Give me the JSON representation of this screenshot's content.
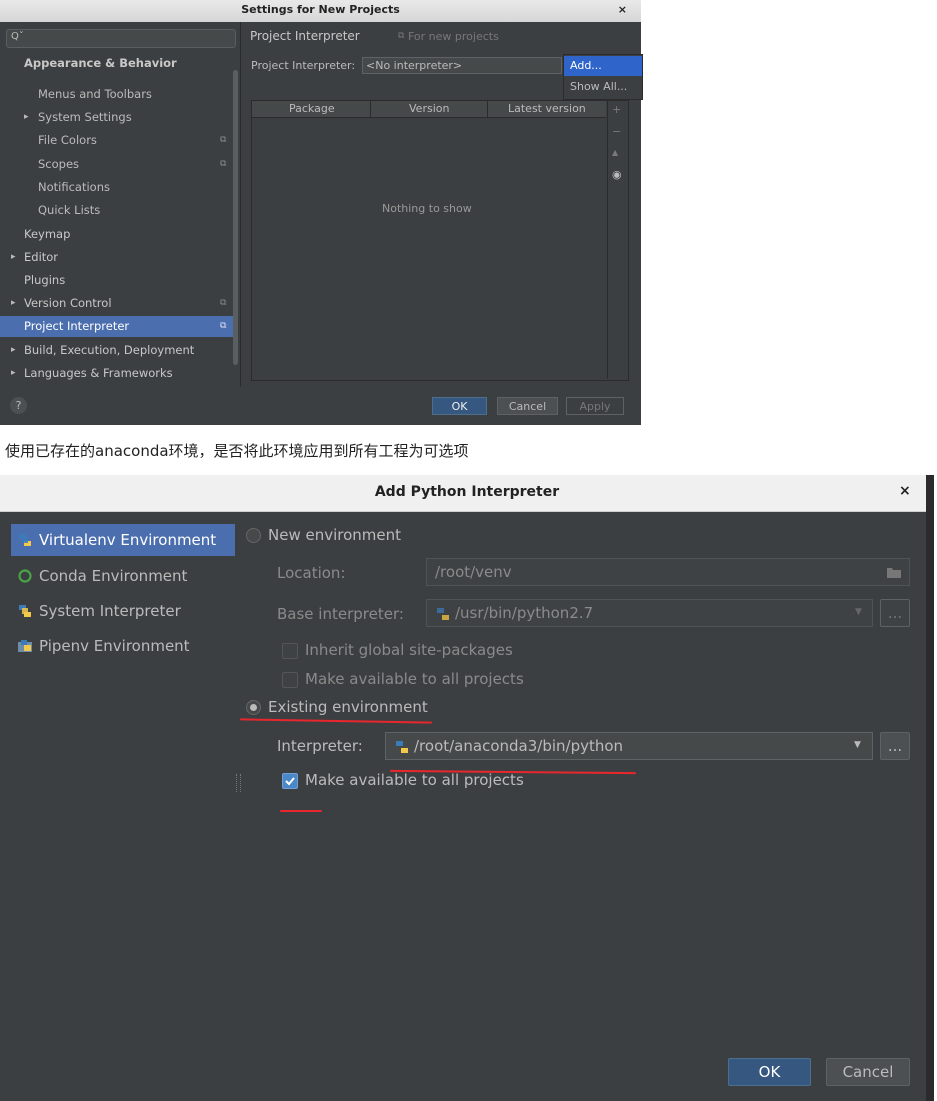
{
  "settings_dialog": {
    "title": "Settings for New Projects",
    "close": "×",
    "search_glyph": "Qˇ",
    "sidebar": {
      "items": [
        {
          "label": "Appearance & Behavior",
          "bold": true
        },
        {
          "label": "Menus and Toolbars"
        },
        {
          "label": "System Settings",
          "arrow": "▸"
        },
        {
          "label": "File Colors",
          "copy": "⧉"
        },
        {
          "label": "Scopes",
          "copy": "⧉"
        },
        {
          "label": "Notifications"
        },
        {
          "label": "Quick Lists"
        },
        {
          "label": "Keymap"
        },
        {
          "label": "Editor",
          "arrow": "▸"
        },
        {
          "label": "Plugins"
        },
        {
          "label": "Version Control",
          "arrow": "▸",
          "copy": "⧉"
        },
        {
          "label": "Project Interpreter",
          "copy": "⧉",
          "selected": true
        },
        {
          "label": "Build, Execution, Deployment",
          "arrow": "▸"
        },
        {
          "label": "Languages & Frameworks",
          "arrow": "▸"
        }
      ]
    },
    "header": {
      "title": "Project Interpreter",
      "scope_icon": "⧉",
      "scope_label": "For new projects"
    },
    "interpreter_label": "Project Interpreter:",
    "interpreter_value": "<No interpreter>",
    "menu": {
      "items": [
        "Add...",
        "Show All..."
      ]
    },
    "table": {
      "columns": [
        "Package",
        "Version",
        "Latest version"
      ],
      "empty_text": "Nothing to show"
    },
    "tools": [
      "+",
      "−",
      "▲",
      "◉"
    ],
    "footer": {
      "help": "?",
      "ok": "OK",
      "cancel": "Cancel",
      "apply": "Apply"
    }
  },
  "caption": "使用已存在的anaconda环境，是否将此环境应用到所有工程为可选项",
  "add_interpreter_dialog": {
    "title": "Add Python Interpreter",
    "close": "×",
    "sidebar": {
      "items": [
        {
          "label": "Virtualenv Environment",
          "icon": "python-icon",
          "selected": true
        },
        {
          "label": "Conda Environment",
          "icon": "conda-icon"
        },
        {
          "label": "System Interpreter",
          "icon": "python-icon"
        },
        {
          "label": "Pipenv Environment",
          "icon": "pipenv-icon"
        }
      ]
    },
    "new_env": {
      "label": "New environment",
      "location_label": "Location:",
      "location_value": "/root/venv",
      "base_label": "Base interpreter:",
      "base_value": "/usr/bin/python2.7",
      "inherit_label": "Inherit global site-packages",
      "make_available_label": "Make available to all projects"
    },
    "existing_env": {
      "label": "Existing environment",
      "interpreter_label": "Interpreter:",
      "interpreter_value": "/root/anaconda3/bin/python",
      "make_available_label": "Make available to all projects",
      "make_available_checked": true
    },
    "browse_button": "...",
    "footer": {
      "ok": "OK",
      "cancel": "Cancel"
    }
  },
  "colors": {
    "selection": "#4b6eaf",
    "annotation": "#e8262d",
    "background": "#3c3f41"
  }
}
